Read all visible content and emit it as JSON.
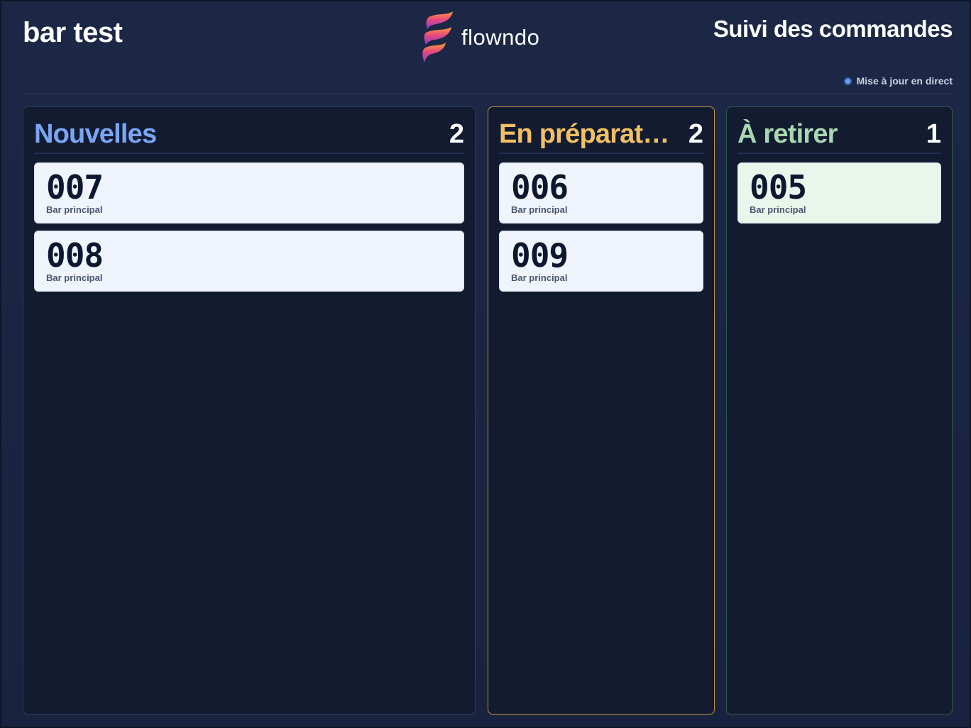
{
  "header": {
    "venue": "bar test",
    "brand": "flowndo",
    "screen_title": "Suivi des commandes",
    "live_status": "Mise à jour en direct"
  },
  "colors": {
    "background": "#1a2541",
    "column_bg": "#121b30",
    "new_accent": "#7aa5f4",
    "prep_accent": "#f2c063",
    "ready_accent": "#a8d8b3",
    "card_bg": "#eff4fd",
    "ready_card_bg": "#e9f6ec"
  },
  "columns": [
    {
      "key": "new",
      "title": "Nouvelles",
      "count": "2",
      "orders": [
        {
          "number": "007",
          "location": "Bar principal"
        },
        {
          "number": "008",
          "location": "Bar principal"
        }
      ]
    },
    {
      "key": "prep",
      "title": "En préparation",
      "count": "2",
      "orders": [
        {
          "number": "006",
          "location": "Bar principal"
        },
        {
          "number": "009",
          "location": "Bar principal"
        }
      ]
    },
    {
      "key": "ready",
      "title": "À retirer",
      "count": "1",
      "orders": [
        {
          "number": "005",
          "location": "Bar principal"
        }
      ]
    }
  ]
}
